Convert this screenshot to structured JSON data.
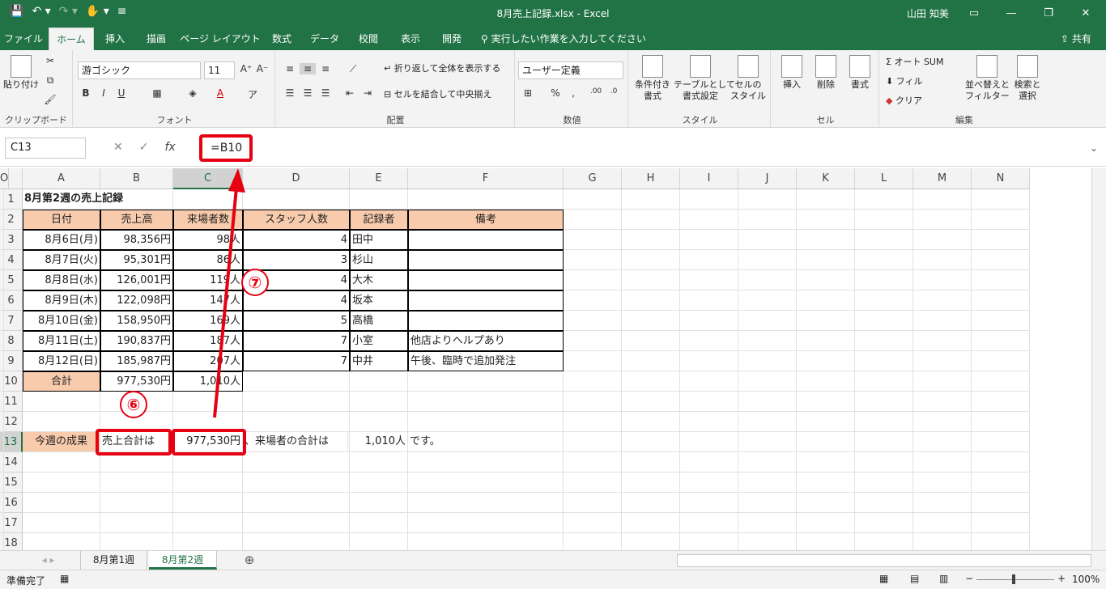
{
  "app": {
    "title": "8月売上記録.xlsx - Excel",
    "user": "山田 知美"
  },
  "tabs": [
    "ファイル",
    "ホーム",
    "挿入",
    "描画",
    "ページ レイアウト",
    "数式",
    "データ",
    "校閲",
    "表示",
    "開発"
  ],
  "tell_me": "実行したい作業を入力してください",
  "share": "共有",
  "ribbon": {
    "clipboard": {
      "label": "クリップボード",
      "paste": "貼り付け"
    },
    "font": {
      "label": "フォント",
      "name": "游ゴシック",
      "size": "11"
    },
    "alignment": {
      "label": "配置",
      "wrap": "折り返して全体を表示する",
      "merge": "セルを結合して中央揃え"
    },
    "number": {
      "label": "数値",
      "format": "ユーザー定義"
    },
    "styles": {
      "label": "スタイル",
      "cond": "条件付き\n書式",
      "table": "テーブルとして\n書式設定",
      "cell": "セルの\nスタイル"
    },
    "cells": {
      "label": "セル",
      "insert": "挿入",
      "delete": "削除",
      "format": "書式"
    },
    "editing": {
      "label": "編集",
      "autosum": "オート SUM",
      "fill": "フィル",
      "clear": "クリア",
      "sort": "並べ替えと\nフィルター",
      "find": "検索と\n選択"
    }
  },
  "formula_bar": {
    "name_box": "C13",
    "formula": "=B10"
  },
  "columns": [
    "A",
    "B",
    "C",
    "D",
    "E",
    "F",
    "G",
    "H",
    "I",
    "J",
    "K",
    "L",
    "M",
    "N",
    "O"
  ],
  "rows": [
    "1",
    "2",
    "3",
    "4",
    "5",
    "6",
    "7",
    "8",
    "9",
    "10",
    "11",
    "12",
    "13",
    "14",
    "15",
    "16",
    "17",
    "18"
  ],
  "sheet": {
    "title": "8月第2週の売上記録",
    "headers": [
      "日付",
      "売上高",
      "来場者数",
      "スタッフ人数",
      "記録者",
      "備考"
    ],
    "data": [
      [
        "8月6日(月)",
        "98,356円",
        "98人",
        "4",
        "田中",
        ""
      ],
      [
        "8月7日(火)",
        "95,301円",
        "86人",
        "3",
        "杉山",
        ""
      ],
      [
        "8月8日(水)",
        "126,001円",
        "119人",
        "4",
        "大木",
        ""
      ],
      [
        "8月9日(木)",
        "122,098円",
        "147人",
        "4",
        "坂本",
        ""
      ],
      [
        "8月10日(金)",
        "158,950円",
        "169人",
        "5",
        "高橋",
        ""
      ],
      [
        "8月11日(土)",
        "190,837円",
        "187人",
        "7",
        "小室",
        "他店よりヘルプあり"
      ],
      [
        "8月12日(日)",
        "185,987円",
        "207人",
        "7",
        "中井",
        "午後、臨時で追加発注"
      ]
    ],
    "total": [
      "合計",
      "977,530円",
      "1,010人"
    ],
    "row13": [
      "今週の成果",
      "売上合計は",
      "977,530円",
      "、来場者の合計は",
      "1,010人",
      "です。"
    ]
  },
  "annotations": {
    "six": "⑥",
    "seven": "⑦"
  },
  "sheet_tabs": [
    "8月第1週",
    "8月第2週"
  ],
  "status": {
    "ready": "準備完了",
    "zoom": "100%"
  },
  "colors": {
    "excel_green": "#217346",
    "header_fill": "#f8cbad",
    "annotation_red": "#e60012"
  }
}
